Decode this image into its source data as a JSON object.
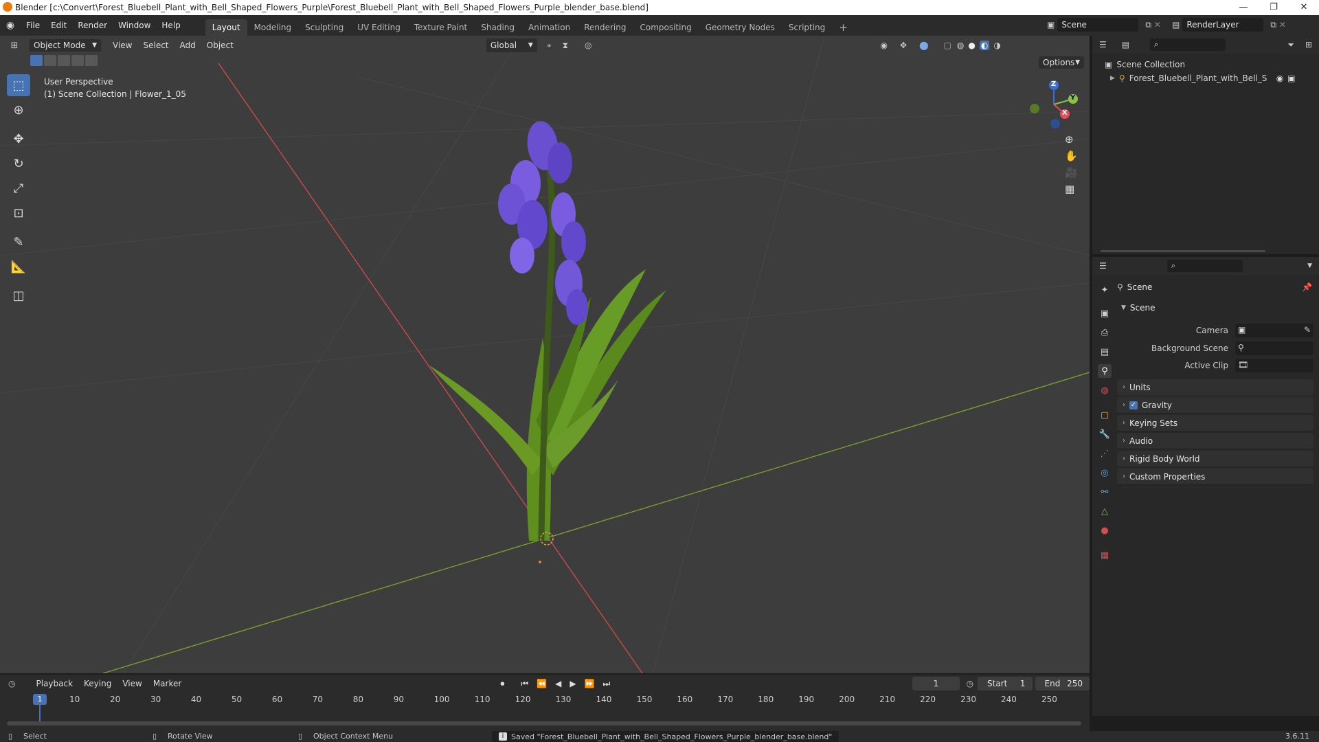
{
  "window": {
    "title": "Blender [c:\\Convert\\Forest_Bluebell_Plant_with_Bell_Shaped_Flowers_Purple\\Forest_Bluebell_Plant_with_Bell_Shaped_Flowers_Purple_blender_base.blend]",
    "minimize": "—",
    "maximize": "❐",
    "close": "✕"
  },
  "menu": [
    "File",
    "Edit",
    "Render",
    "Window",
    "Help"
  ],
  "workspaces": [
    "Layout",
    "Modeling",
    "Sculpting",
    "UV Editing",
    "Texture Paint",
    "Shading",
    "Animation",
    "Rendering",
    "Compositing",
    "Geometry Nodes",
    "Scripting"
  ],
  "workspace_add": "+",
  "scene_field": "Scene",
  "renderlayer_field": "RenderLayer",
  "viewport": {
    "mode": "Object Mode",
    "menus": [
      "View",
      "Select",
      "Add",
      "Object"
    ],
    "orientation": "Global",
    "options": "Options",
    "overlay_line1": "User Perspective",
    "overlay_line2": "(1) Scene Collection | Flower_1_05",
    "gizmo": {
      "z": "Z",
      "y": "Y",
      "x": "X"
    }
  },
  "outliner": {
    "root": "Scene Collection",
    "item": "Forest_Bluebell_Plant_with_Bell_Shapec"
  },
  "properties": {
    "header": "Scene",
    "section": "Scene",
    "camera_label": "Camera",
    "background_label": "Background Scene",
    "clip_label": "Active Clip",
    "panels": [
      "Units",
      "Gravity",
      "Keying Sets",
      "Audio",
      "Rigid Body World",
      "Custom Properties"
    ],
    "gravity_checked": true
  },
  "timeline": {
    "menus": [
      "Playback",
      "Keying",
      "View",
      "Marker"
    ],
    "current_frame": "1",
    "start_label": "Start",
    "start_value": "1",
    "end_label": "End",
    "end_value": "250",
    "ticks": [
      "1",
      "10",
      "20",
      "30",
      "40",
      "50",
      "60",
      "70",
      "80",
      "90",
      "100",
      "110",
      "120",
      "130",
      "140",
      "150",
      "160",
      "170",
      "180",
      "190",
      "200",
      "210",
      "220",
      "230",
      "240",
      "250"
    ]
  },
  "status": {
    "select": "Select",
    "rotate": "Rotate View",
    "context": "Object Context Menu",
    "message": "Saved \"Forest_Bluebell_Plant_with_Bell_Shaped_Flowers_Purple_blender_base.blend\"",
    "version": "3.6.11"
  },
  "colors": {
    "accent": "#4772b3",
    "x_axis": "#c84b4b",
    "y_axis": "#7a9f2c",
    "flower": "#6a4fd0",
    "leaf": "#5f8f1f"
  }
}
